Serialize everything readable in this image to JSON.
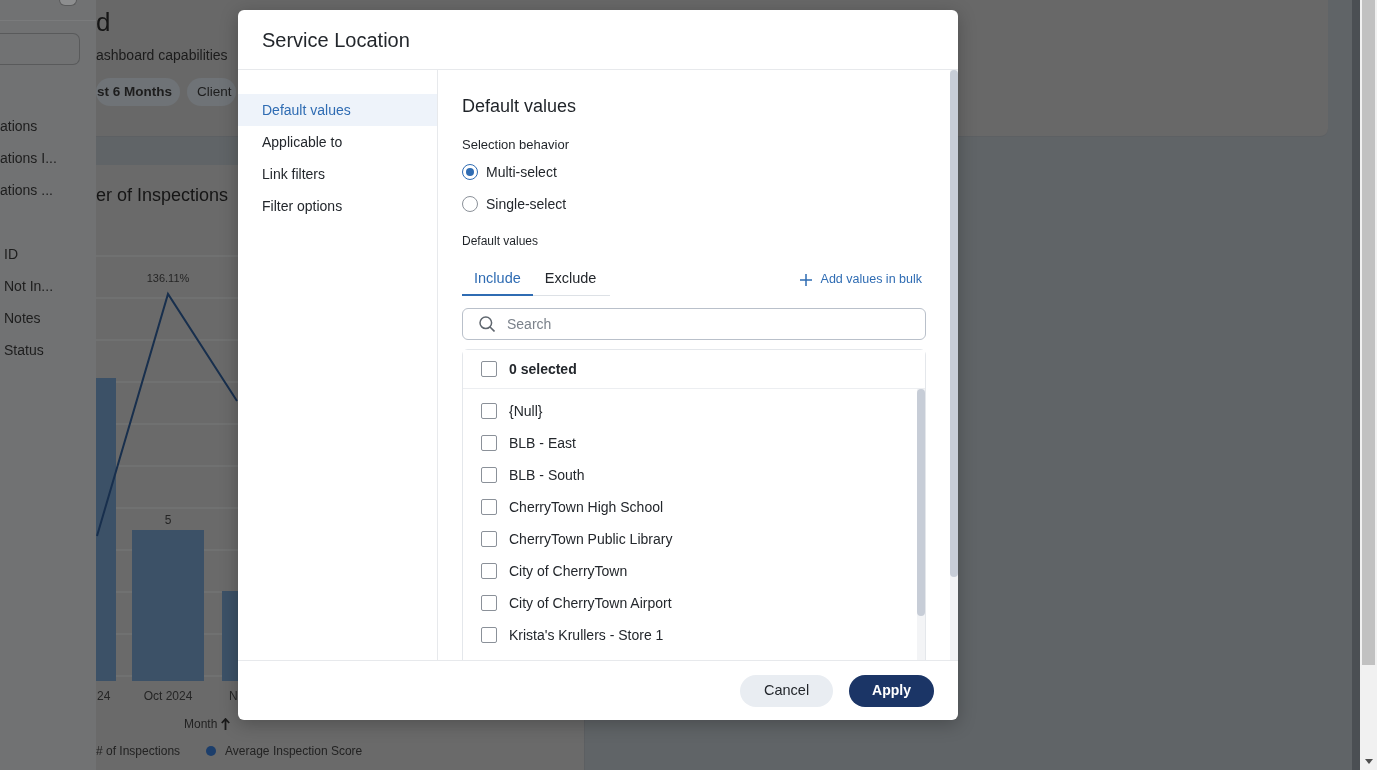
{
  "side_panel": {
    "groups": [
      {
        "items": [
          "ations",
          "ations I...",
          "ations ..."
        ]
      },
      {
        "items": [
          "ID",
          "Not In...",
          "Notes",
          "Status"
        ]
      }
    ]
  },
  "dashboard": {
    "title": "d",
    "subtitle": "ashboard capabilities",
    "chips": [
      {
        "label": "st 6 Months",
        "selected": true
      },
      {
        "label": "Client",
        "selected": false
      }
    ]
  },
  "chart": {
    "title": "er of Inspections",
    "data_labels": [
      "136.11%",
      "5"
    ],
    "x_labels": [
      "24",
      "Oct 2024",
      "N"
    ],
    "axis_title": "Month",
    "legend": [
      {
        "label": "# of Inspections"
      },
      {
        "label": "Average Inspection Score",
        "color": "#1c3e6b"
      }
    ]
  },
  "dialog": {
    "title": "Service Location",
    "nav": [
      {
        "label": "Default values",
        "selected": true
      },
      {
        "label": "Applicable to",
        "selected": false
      },
      {
        "label": "Link filters",
        "selected": false
      },
      {
        "label": "Filter options",
        "selected": false
      }
    ],
    "section_title": "Default values",
    "selection_behavior": {
      "label": "Selection behavior",
      "options": [
        {
          "label": "Multi-select",
          "selected": true
        },
        {
          "label": "Single-select",
          "selected": false
        }
      ]
    },
    "default_values": {
      "label": "Default values",
      "tabs": [
        {
          "label": "Include",
          "selected": true
        },
        {
          "label": "Exclude",
          "selected": false
        }
      ],
      "bulk_link": "Add values in bulk",
      "search": {
        "placeholder": "Search"
      },
      "select_all": {
        "label": "0 selected",
        "checked": false
      },
      "values": [
        {
          "label": "{Null}",
          "checked": false
        },
        {
          "label": "BLB - East",
          "checked": false
        },
        {
          "label": "BLB - South",
          "checked": false
        },
        {
          "label": "CherryTown High School",
          "checked": false
        },
        {
          "label": "CherryTown Public Library",
          "checked": false
        },
        {
          "label": "City of CherryTown",
          "checked": false
        },
        {
          "label": "City of CherryTown Airport",
          "checked": false
        },
        {
          "label": "Krista's Krullers - Store 1",
          "checked": false
        }
      ]
    },
    "buttons": [
      {
        "label": "Cancel",
        "kind": "secondary"
      },
      {
        "label": "Apply",
        "kind": "primary"
      }
    ]
  }
}
